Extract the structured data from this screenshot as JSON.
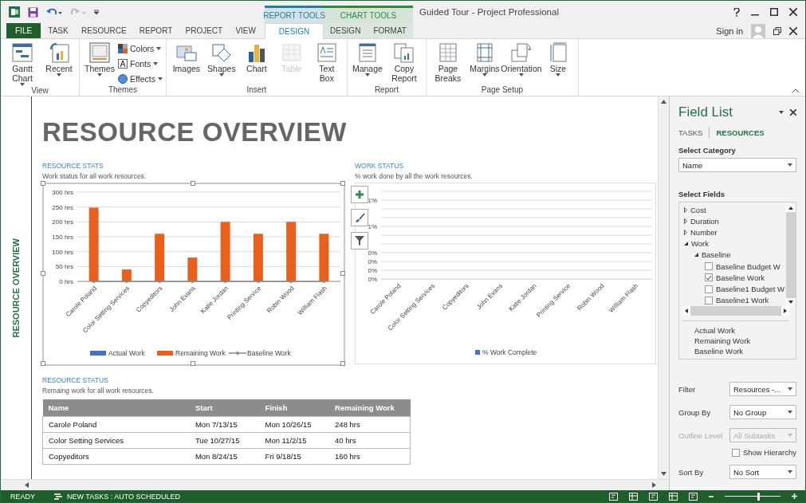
{
  "window": {
    "title": "Guided Tour - Project Professional",
    "sign_in": "Sign in"
  },
  "tabs": [
    {
      "label": "FILE",
      "kind": "file",
      "selected": false
    },
    {
      "label": "TASK",
      "kind": "plain",
      "selected": false
    },
    {
      "label": "RESOURCE",
      "kind": "plain",
      "selected": false
    },
    {
      "label": "REPORT",
      "kind": "plain",
      "selected": false
    },
    {
      "label": "PROJECT",
      "kind": "plain",
      "selected": false
    },
    {
      "label": "VIEW",
      "kind": "plain",
      "selected": false
    }
  ],
  "context_tabs": [
    {
      "label": "REPORT TOOLS",
      "color": "#1f7fa6",
      "tabs": [
        {
          "label": "DESIGN",
          "selected": true
        }
      ]
    },
    {
      "label": "CHART TOOLS",
      "color": "#2e8b3a",
      "tabs": [
        {
          "label": "DESIGN",
          "selected": false
        },
        {
          "label": "FORMAT",
          "selected": false
        }
      ]
    }
  ],
  "ribbon": [
    {
      "label": "View",
      "buttons": [
        {
          "label": "Gantt Chart",
          "kind": "large",
          "menu": true,
          "disabled": false
        },
        {
          "label": "Recent",
          "kind": "large",
          "menu": true,
          "disabled": false
        }
      ]
    },
    {
      "label": "Themes",
      "buttons": [
        {
          "label": "Themes",
          "kind": "large",
          "menu": true,
          "disabled": false
        },
        {
          "label": "Colors",
          "kind": "small",
          "menu": true,
          "disabled": false
        },
        {
          "label": "Fonts",
          "kind": "small",
          "menu": true,
          "disabled": false
        },
        {
          "label": "Effects",
          "kind": "small",
          "menu": true,
          "disabled": false
        }
      ]
    },
    {
      "label": "Insert",
      "buttons": [
        {
          "label": "Images",
          "kind": "large",
          "menu": false,
          "disabled": false
        },
        {
          "label": "Shapes",
          "kind": "large",
          "menu": true,
          "disabled": false
        },
        {
          "label": "Chart",
          "kind": "large",
          "menu": false,
          "disabled": false
        },
        {
          "label": "Table",
          "kind": "large",
          "menu": false,
          "disabled": true
        },
        {
          "label": "Text Box",
          "kind": "large",
          "menu": false,
          "disabled": false
        }
      ]
    },
    {
      "label": "Report",
      "buttons": [
        {
          "label": "Manage",
          "kind": "large",
          "menu": true,
          "disabled": false
        },
        {
          "label": "Copy Report",
          "kind": "large",
          "menu": false,
          "disabled": false
        }
      ]
    },
    {
      "label": "Page Setup",
      "buttons": [
        {
          "label": "Page Breaks",
          "kind": "large",
          "menu": false,
          "disabled": false
        },
        {
          "label": "Margins",
          "kind": "large",
          "menu": true,
          "disabled": false
        },
        {
          "label": "Orientation",
          "kind": "large",
          "menu": true,
          "disabled": false
        },
        {
          "label": "Size",
          "kind": "large",
          "menu": true,
          "disabled": false
        }
      ]
    }
  ],
  "report": {
    "side_label": "RESOURCE OVERVIEW",
    "title": "RESOURCE OVERVIEW",
    "resource_stats": {
      "heading": "RESOURCE STATS",
      "subtitle": "Work status for all work resources.",
      "chart_data": {
        "type": "bar",
        "categories": [
          "Carole Poland",
          "Color Setting Services",
          "Copyeditors",
          "John Evans",
          "Katie Jordan",
          "Printing Service",
          "Robin Wood",
          "William Flash"
        ],
        "series": [
          {
            "name": "Actual Work",
            "color": "#4472c4",
            "values": [
              0,
              0,
              0,
              0,
              0,
              0,
              0,
              0
            ]
          },
          {
            "name": "Remaining Work",
            "color": "#e8601c",
            "values": [
              248,
              40,
              160,
              80,
              200,
              160,
              200,
              160
            ]
          },
          {
            "name": "Baseline Work",
            "color": "#8a8a8a",
            "values": [
              0,
              0,
              0,
              0,
              0,
              0,
              0,
              0
            ]
          }
        ],
        "grid": true,
        "ylim": [
          0,
          300
        ],
        "yticks": [
          {
            "value": 0,
            "label": "0 hrs"
          },
          {
            "value": 50,
            "label": "50 hrs"
          },
          {
            "value": 100,
            "label": "100 hrs"
          },
          {
            "value": 150,
            "label": "150 hrs"
          },
          {
            "value": 200,
            "label": "200 hrs"
          },
          {
            "value": 250,
            "label": "250 hrs"
          },
          {
            "value": 300,
            "label": "300 hrs"
          }
        ]
      }
    },
    "work_status": {
      "heading": "WORK STATUS",
      "subtitle": "% work done by all the work resources.",
      "chart_data": {
        "type": "bar",
        "categories": [
          "Carole Poland",
          "Color Setting Services",
          "Copyeditors",
          "John Evans",
          "Katie Jordan",
          "Printing Service",
          "Robin Wood",
          "William Flash"
        ],
        "series": [
          {
            "name": "% Work Complete",
            "color": "#4472c4",
            "values": [
              0,
              0,
              0,
              0,
              0,
              0,
              0,
              0
            ]
          }
        ],
        "grid": true,
        "ylim": [
          0,
          0.01
        ],
        "yticks": [
          {
            "value": 0,
            "label": "0%"
          },
          {
            "value": 0.001,
            "label": "0%"
          },
          {
            "value": 0.002,
            "label": "0%"
          },
          {
            "value": 0.003,
            "label": "0%"
          },
          {
            "value": 0.006,
            "label": "1%"
          },
          {
            "value": 0.009,
            "label": "1%"
          }
        ]
      }
    },
    "resource_status": {
      "heading": "RESOURCE STATUS",
      "subtitle": "Remaing work for all work resources.",
      "columns": [
        "Name",
        "Start",
        "Finish",
        "Remaining Work"
      ],
      "rows": [
        [
          "Carole Poland",
          "Mon 7/13/15",
          "Mon 10/26/15",
          "248 hrs"
        ],
        [
          "Color Setting Services",
          "Tue 10/27/15",
          "Mon 11/2/15",
          "40 hrs"
        ],
        [
          "Copyeditors",
          "Mon 8/24/15",
          "Fri 9/18/15",
          "160 hrs"
        ]
      ]
    }
  },
  "field_list": {
    "title": "Field List",
    "tabs": [
      {
        "label": "TASKS",
        "selected": false
      },
      {
        "label": "RESOURCES",
        "selected": true
      }
    ],
    "category_label": "Select Category",
    "category": "Name",
    "fields_label": "Select Fields",
    "tree": [
      {
        "label": "Cost",
        "expanded": false
      },
      {
        "label": "Duration",
        "expanded": false
      },
      {
        "label": "Number",
        "expanded": false
      },
      {
        "label": "Work",
        "expanded": true,
        "children": [
          {
            "label": "Baseline",
            "expanded": true,
            "children": [
              {
                "label": "Baseline Budget W",
                "checked": false
              },
              {
                "label": "Baseline Work",
                "checked": true
              },
              {
                "label": "Baseline1 Budget W",
                "checked": false
              },
              {
                "label": "Baseline1 Work",
                "checked": false
              }
            ]
          }
        ]
      }
    ],
    "selected_fields": [
      "Actual Work",
      "Remaining Work",
      "Baseline Work"
    ],
    "options": [
      {
        "label": "Filter",
        "value": "Resources -...",
        "disabled": false
      },
      {
        "label": "Group By",
        "value": "No Group",
        "disabled": false
      },
      {
        "label": "Outline Level",
        "value": "All Subtasks",
        "disabled": true
      }
    ],
    "show_hierarchy": {
      "label": "Show Hierarchy",
      "checked": false
    },
    "sort": {
      "label": "Sort By",
      "value": "No Sort",
      "disabled": false
    }
  },
  "status_bar": {
    "ready": "READY",
    "new_tasks": "NEW TASKS : AUTO SCHEDULED",
    "zoom": {
      "level": 0.6
    }
  }
}
